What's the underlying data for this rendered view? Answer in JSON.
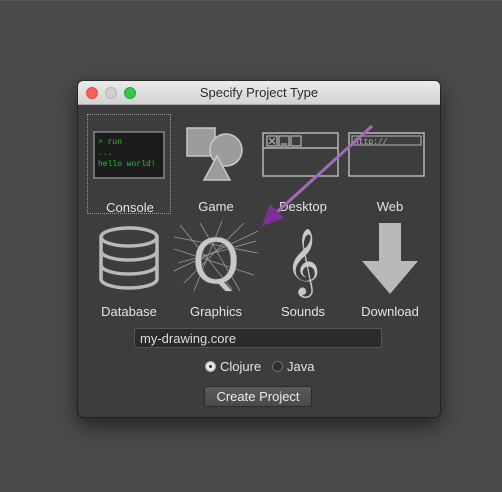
{
  "window": {
    "title": "Specify Project Type"
  },
  "tiles": [
    {
      "label": "Console",
      "icon": "console-icon",
      "console_lines": [
        "> run",
        "...",
        "hello world!"
      ]
    },
    {
      "label": "Game",
      "icon": "game-shapes-icon"
    },
    {
      "label": "Desktop",
      "icon": "desktop-window-icon"
    },
    {
      "label": "Web",
      "icon": "web-browser-icon",
      "url_text": "http://"
    },
    {
      "label": "Database",
      "icon": "database-icon"
    },
    {
      "label": "Graphics",
      "icon": "graphics-q-icon",
      "glyph": "Q"
    },
    {
      "label": "Sounds",
      "icon": "treble-clef-icon",
      "glyph": "𝄞"
    },
    {
      "label": "Download",
      "icon": "download-arrow-icon"
    }
  ],
  "selected_tile": "Console",
  "project_name": {
    "value": "my-drawing.core"
  },
  "language": {
    "options": [
      "Clojure",
      "Java"
    ],
    "selected": "Clojure"
  },
  "create_button": {
    "label": "Create Project"
  },
  "colors": {
    "background": "#4a4a4a",
    "window": "#3d3d3d",
    "console_text": "#29c229",
    "annotation_arrow": "#8e3fa6",
    "icon_gray": "#b9b9b9"
  }
}
